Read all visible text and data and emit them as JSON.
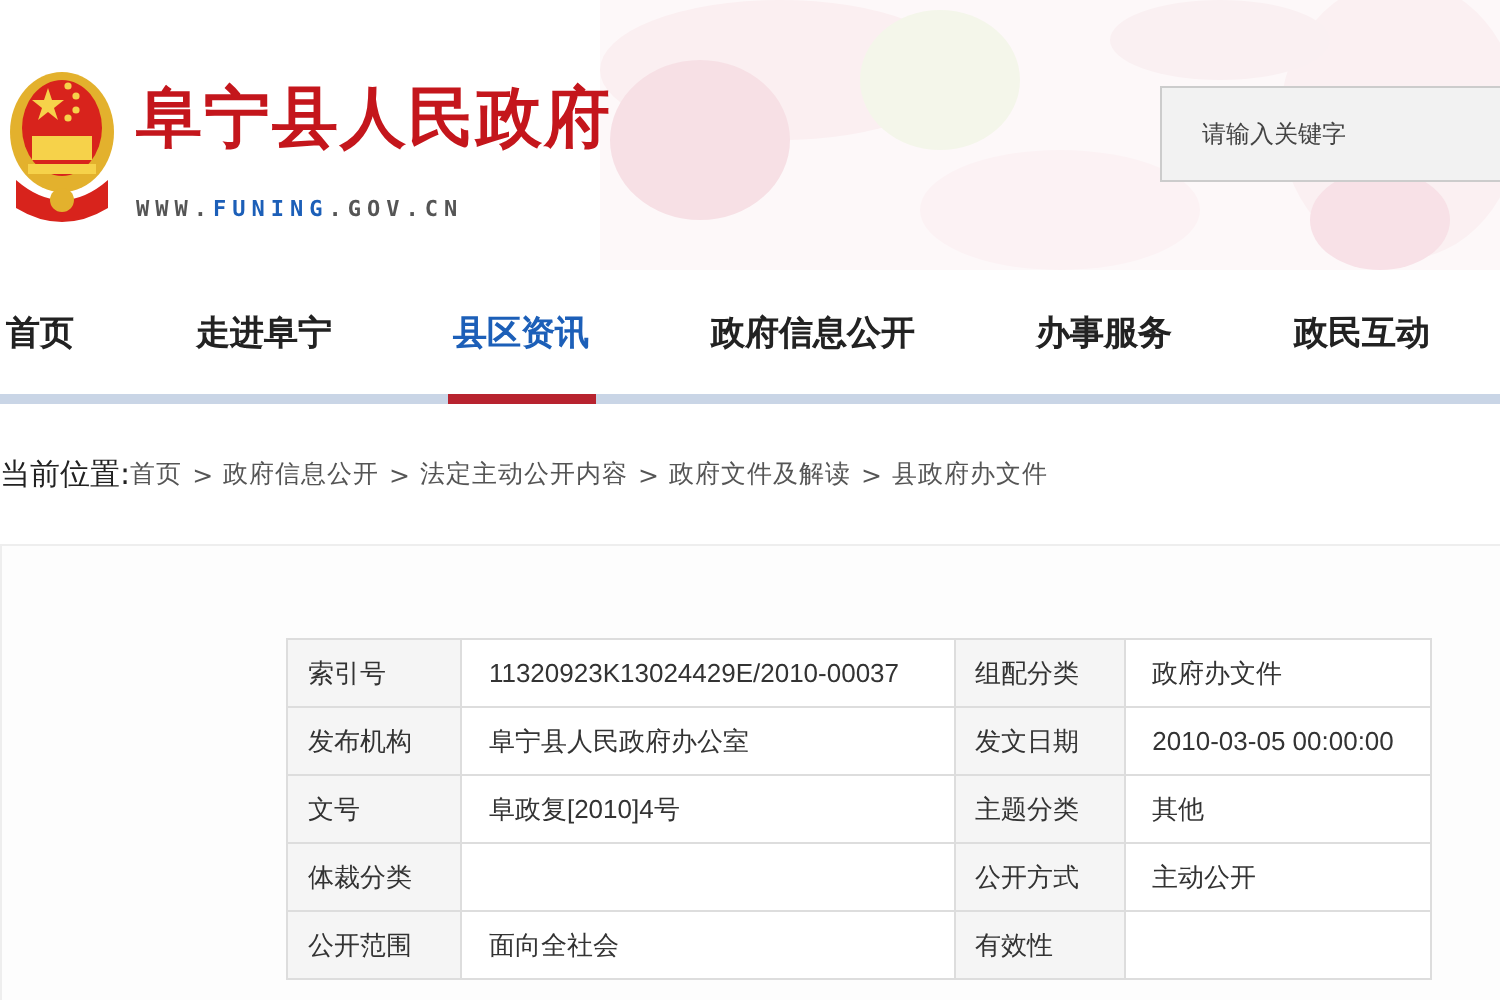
{
  "header": {
    "site_name": "阜宁县人民政府",
    "url": {
      "prefix": "WWW.",
      "highlight": "FUNING",
      "suffix": ".GOV.CN"
    },
    "search": {
      "placeholder": "请输入关键字"
    }
  },
  "nav": [
    {
      "label": "首页",
      "selected": false
    },
    {
      "label": "走进阜宁",
      "selected": false
    },
    {
      "label": "县区资讯",
      "selected": true
    },
    {
      "label": "政府信息公开",
      "selected": false
    },
    {
      "label": "办事服务",
      "selected": false
    },
    {
      "label": "政民互动",
      "selected": false
    }
  ],
  "breadcrumb": {
    "label": "当前位置:",
    "separator": ">",
    "items": [
      "首页",
      "政府信息公开",
      "法定主动公开内容",
      "政府文件及解读",
      "县政府办文件"
    ]
  },
  "metadata": [
    [
      {
        "label": "索引号",
        "value": "11320923K13024429E/2010-00037"
      },
      {
        "label": "组配分类",
        "value": "政府办文件"
      }
    ],
    [
      {
        "label": "发布机构",
        "value": "阜宁县人民政府办公室"
      },
      {
        "label": "发文日期",
        "value": "2010-03-05 00:00:00"
      }
    ],
    [
      {
        "label": "文号",
        "value": "阜政复[2010]4号"
      },
      {
        "label": "主题分类",
        "value": "其他"
      }
    ],
    [
      {
        "label": "体裁分类"
      },
      {
        "label": "公开方式",
        "value": "主动公开"
      }
    ],
    [
      {
        "label": "公开范围",
        "value": "面向全社会"
      },
      {
        "label": "有效性"
      }
    ]
  ]
}
